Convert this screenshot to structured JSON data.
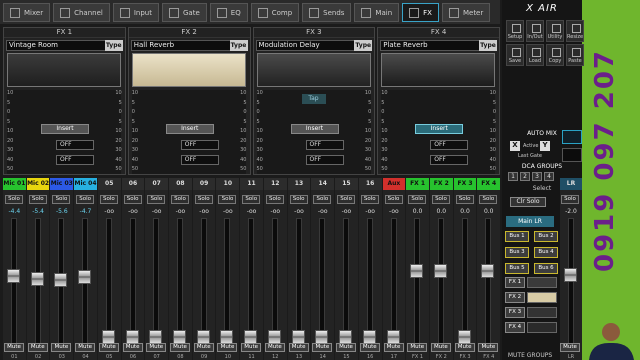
{
  "tabs": [
    {
      "label": "Mixer",
      "icon": "mixer-icon"
    },
    {
      "label": "Channel",
      "icon": "channel-icon"
    },
    {
      "label": "Input",
      "icon": "input-icon"
    },
    {
      "label": "Gate",
      "icon": "gate-icon"
    },
    {
      "label": "EQ",
      "icon": "eq-icon"
    },
    {
      "label": "Comp",
      "icon": "comp-icon"
    },
    {
      "label": "Sends",
      "icon": "sends-icon"
    },
    {
      "label": "Main",
      "icon": "main-icon"
    },
    {
      "label": "FX",
      "icon": "fx-icon",
      "active": true
    },
    {
      "label": "Meter",
      "icon": "meter-icon"
    }
  ],
  "fx": [
    {
      "title": "FX 1",
      "preset": "Vintage Room",
      "type_label": "Type",
      "insert": "Insert",
      "off1": "OFF",
      "off2": "OFF"
    },
    {
      "title": "FX 2",
      "preset": "Hall Reverb",
      "type_label": "Type",
      "insert": "Insert",
      "off1": "OFF",
      "off2": "OFF"
    },
    {
      "title": "FX 3",
      "preset": "Modulation Delay",
      "type_label": "Type",
      "tap": "Tap",
      "insert": "Insert",
      "off1": "OFF",
      "off2": "OFF"
    },
    {
      "title": "FX 4",
      "preset": "Plate Reverb",
      "type_label": "Type",
      "insert": "Insert",
      "off1": "OFF",
      "off2": "OFF"
    }
  ],
  "scale": [
    "10",
    "5",
    "0",
    "5",
    "10",
    "20",
    "30",
    "40",
    "50"
  ],
  "strips": [
    {
      "name": "Mic 01",
      "color": "#27c22e",
      "db": "-4.4",
      "num": "01",
      "level": 0.58
    },
    {
      "name": "Mic 02",
      "color": "#e8d60e",
      "db": "-5.4",
      "num": "02",
      "level": 0.56
    },
    {
      "name": "Mic 03",
      "color": "#2c59e6",
      "db": "-5.6",
      "num": "03",
      "level": 0.55
    },
    {
      "name": "Mic 04",
      "color": "#27b0e0",
      "db": "-4.7",
      "num": "04",
      "level": 0.57
    },
    {
      "name": "05",
      "color": "",
      "db": "-oo",
      "num": "05",
      "level": 0.08
    },
    {
      "name": "06",
      "color": "",
      "db": "-oo",
      "num": "06",
      "level": 0.08
    },
    {
      "name": "07",
      "color": "",
      "db": "-oo",
      "num": "07",
      "level": 0.08
    },
    {
      "name": "08",
      "color": "",
      "db": "-oo",
      "num": "08",
      "level": 0.08
    },
    {
      "name": "09",
      "color": "",
      "db": "-oo",
      "num": "09",
      "level": 0.08
    },
    {
      "name": "10",
      "color": "",
      "db": "-oo",
      "num": "10",
      "level": 0.08
    },
    {
      "name": "11",
      "color": "",
      "db": "-oo",
      "num": "11",
      "level": 0.08
    },
    {
      "name": "12",
      "color": "",
      "db": "-oo",
      "num": "12",
      "level": 0.08
    },
    {
      "name": "13",
      "color": "",
      "db": "-oo",
      "num": "13",
      "level": 0.08
    },
    {
      "name": "14",
      "color": "",
      "db": "-oo",
      "num": "14",
      "level": 0.08
    },
    {
      "name": "15",
      "color": "",
      "db": "-oo",
      "num": "15",
      "level": 0.08
    },
    {
      "name": "16",
      "color": "",
      "db": "-oo",
      "num": "16",
      "level": 0.08
    },
    {
      "name": "Aux",
      "color": "#d2302c",
      "db": "-oo",
      "num": "17",
      "level": 0.08
    },
    {
      "name": "FX 1",
      "color": "#27c22e",
      "db": "0.0",
      "num": "FX 1",
      "level": 0.62
    },
    {
      "name": "FX 2",
      "color": "#27c22e",
      "db": "0.0",
      "num": "FX 2",
      "level": 0.62
    },
    {
      "name": "FX 3",
      "color": "#27c22e",
      "db": "0.0",
      "num": "FX 3",
      "level": 0.08
    },
    {
      "name": "FX 4",
      "color": "#27c22e",
      "db": "0.0",
      "num": "FX 4",
      "level": 0.62
    }
  ],
  "labels": {
    "solo": "Solo",
    "mute": "Mute"
  },
  "side": {
    "logo": "X AIR",
    "buttons": [
      "Setup",
      "In/Out",
      "Utility",
      "Resize",
      "Save",
      "Load",
      "Copy",
      "Paste"
    ],
    "auto_mix": "AUTO MIX",
    "x": "X",
    "active": "Active",
    "y": "Y",
    "last_gate": "Last Gate",
    "dca_groups": "DCA GROUPS",
    "dca": [
      "1",
      "2",
      "3",
      "4"
    ],
    "select": "Select",
    "clr_solo": "Clr Solo",
    "main_lr": "Main LR",
    "bus": [
      "Bus 1",
      "Bus 2",
      "Bus 3",
      "Bus 4",
      "Bus 5",
      "Bus 6"
    ],
    "fx": [
      "FX 1",
      "FX 2",
      "FX 3",
      "FX 4"
    ],
    "mute_groups": "MUTE GROUPS",
    "lr": {
      "name": "LR",
      "db": "-2.0",
      "solo": "Solo",
      "mute": "Mute",
      "num": "LR",
      "level": 0.59
    }
  },
  "phone": "0919 097 207"
}
